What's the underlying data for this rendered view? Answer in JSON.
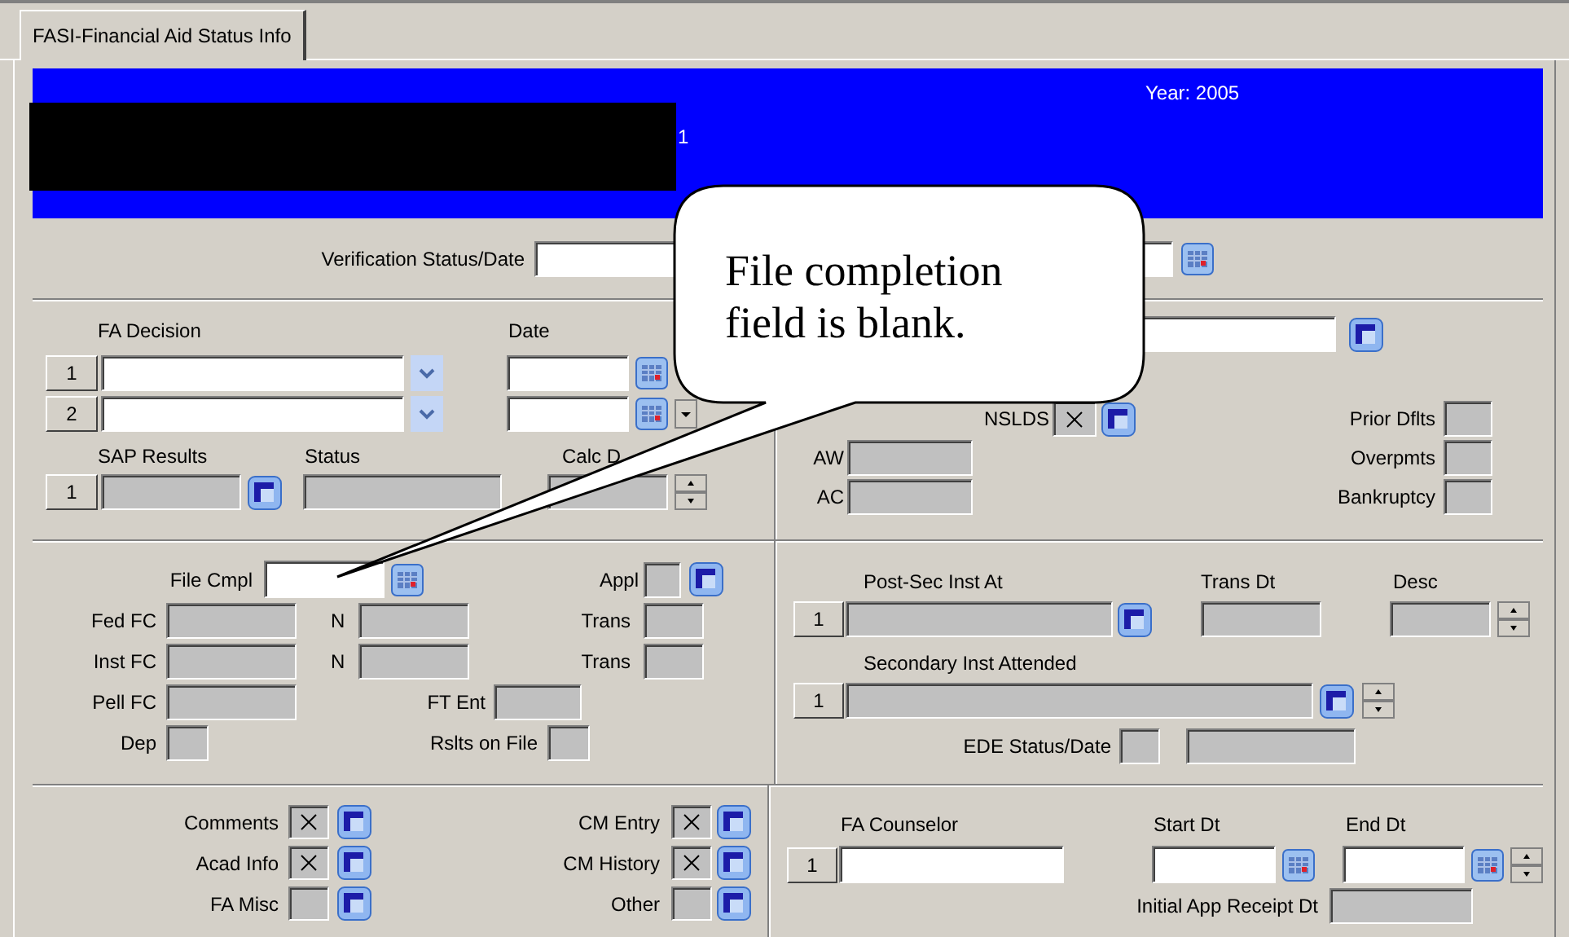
{
  "tab": {
    "label": "FASI-Financial Aid Status Info",
    "selected": true
  },
  "header": {
    "year_label": "Year:",
    "year": "2005",
    "id_suffix": "1"
  },
  "verification": {
    "label": "Verification Status/Date"
  },
  "fa_decision": {
    "label": "FA Decision",
    "date_label": "Date",
    "rows": [
      {
        "number": "1"
      },
      {
        "number": "2"
      }
    ]
  },
  "sap": {
    "label": "SAP Results",
    "status_label": "Status",
    "calc_label": "Calc D",
    "number": "1"
  },
  "nslds": {
    "label": "NSLDS",
    "checked": true
  },
  "aid_fields": [
    "AW",
    "AC"
  ],
  "flags": [
    "Prior Dflts",
    "Overpmts",
    "Bankruptcy"
  ],
  "file_cmpl": {
    "label": "File Cmpl"
  },
  "appl": {
    "label": "Appl",
    "checked": false
  },
  "fc_rows": [
    {
      "label": "Fed FC",
      "n_label": "N",
      "trans_label": "Trans"
    },
    {
      "label": "Inst FC",
      "n_label": "N",
      "trans_label": "Trans"
    }
  ],
  "pell": {
    "label": "Pell FC",
    "ft_label": "FT Ent"
  },
  "dep": {
    "label": "Dep",
    "results_label": "Rslts on File"
  },
  "institutions": {
    "post_sec_label": "Post-Sec Inst At",
    "trans_dt_label": "Trans Dt",
    "desc_label": "Desc",
    "post_sec_number": "1",
    "secondary_label": "Secondary Inst Attended",
    "secondary_number": "1",
    "ede_label": "EDE Status/Date"
  },
  "checks": [
    {
      "label": "Comments",
      "checked": true
    },
    {
      "label": "CM Entry",
      "checked": true
    },
    {
      "label": "Acad Info",
      "checked": true
    },
    {
      "label": "CM History",
      "checked": true
    },
    {
      "label": "FA Misc",
      "checked": false
    },
    {
      "label": "Other",
      "checked": false
    }
  ],
  "counselor": {
    "label": "FA Counselor",
    "start_label": "Start Dt",
    "end_label": "End Dt",
    "number": "1",
    "receipt_label": "Initial App Receipt Dt"
  },
  "callout": {
    "text": "File completion field is blank."
  }
}
